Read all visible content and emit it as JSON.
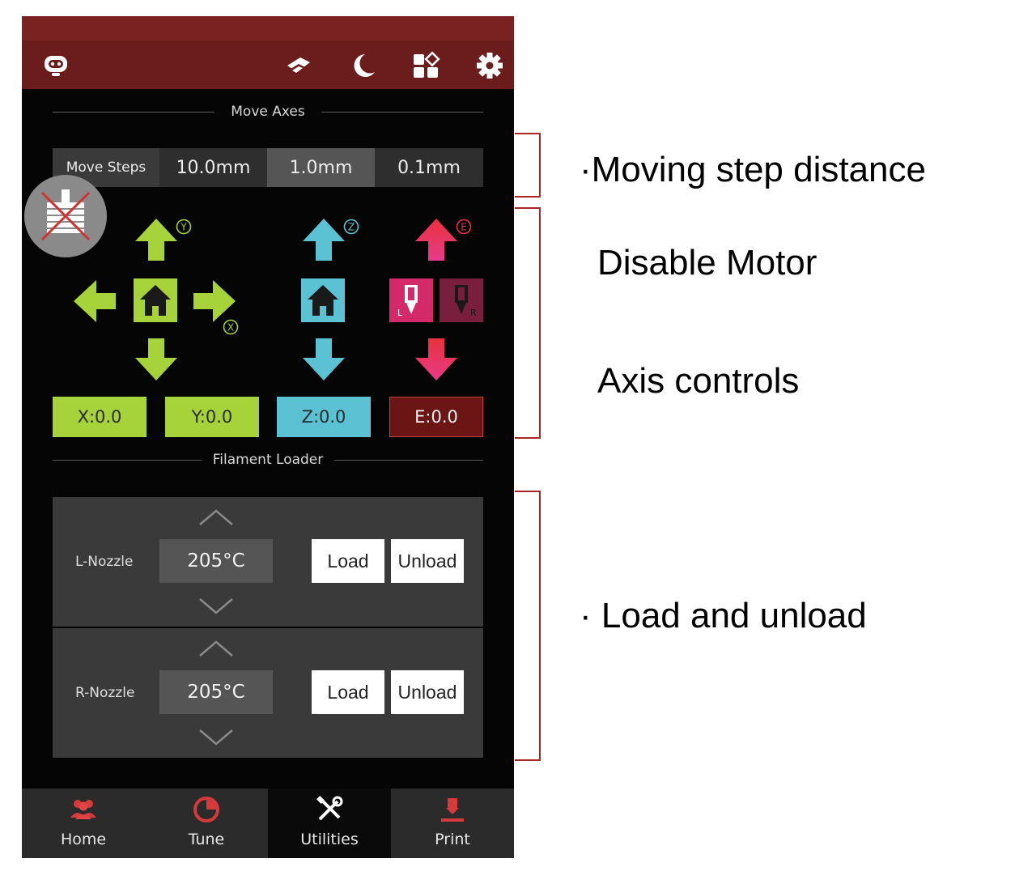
{
  "move_axes": {
    "title": "Move Axes",
    "steps_label": "Move Steps",
    "steps": [
      "10.0mm",
      "1.0mm",
      "0.1mm"
    ],
    "selected_step": "1.0mm"
  },
  "axes": {
    "x_marker": "X",
    "y_marker": "Y",
    "z_marker": "Z",
    "e_marker": "E",
    "extruder_left": "L",
    "extruder_right": "R",
    "x_value": "X:0.0",
    "y_value": "Y:0.0",
    "z_value": "Z:0.0",
    "e_value": "E:0.0"
  },
  "filament": {
    "title": "Filament Loader",
    "nozzles": [
      {
        "label": "L-Nozzle",
        "temp": "205°C",
        "load": "Load",
        "unload": "Unload"
      },
      {
        "label": "R-Nozzle",
        "temp": "205°C",
        "load": "Load",
        "unload": "Unload"
      }
    ]
  },
  "nav": {
    "tabs": [
      {
        "label": "Home",
        "icon": "users-icon"
      },
      {
        "label": "Tune",
        "icon": "pie-chart-icon"
      },
      {
        "label": "Utilities",
        "icon": "tools-icon"
      },
      {
        "label": "Print",
        "icon": "print-icon"
      }
    ],
    "active": "Utilities"
  },
  "topbar_icons": [
    "robot-logo-icon",
    "filament-icon",
    "moon-icon",
    "widgets-icon",
    "gear-icon"
  ],
  "colors": {
    "topbar": "#6b1d1d",
    "x_axis": "#a6d23a",
    "y_axis": "#a6d23a",
    "z_axis": "#5bc2d4",
    "e_axis": "#e83a6a",
    "e_value_bg": "#6b1515",
    "bracket": "#a82626"
  },
  "annotations": {
    "step_distance": "·Moving step distance",
    "disable_motor": "Disable Motor",
    "axis_controls": "Axis controls",
    "load_unload": "· Load and unload"
  }
}
